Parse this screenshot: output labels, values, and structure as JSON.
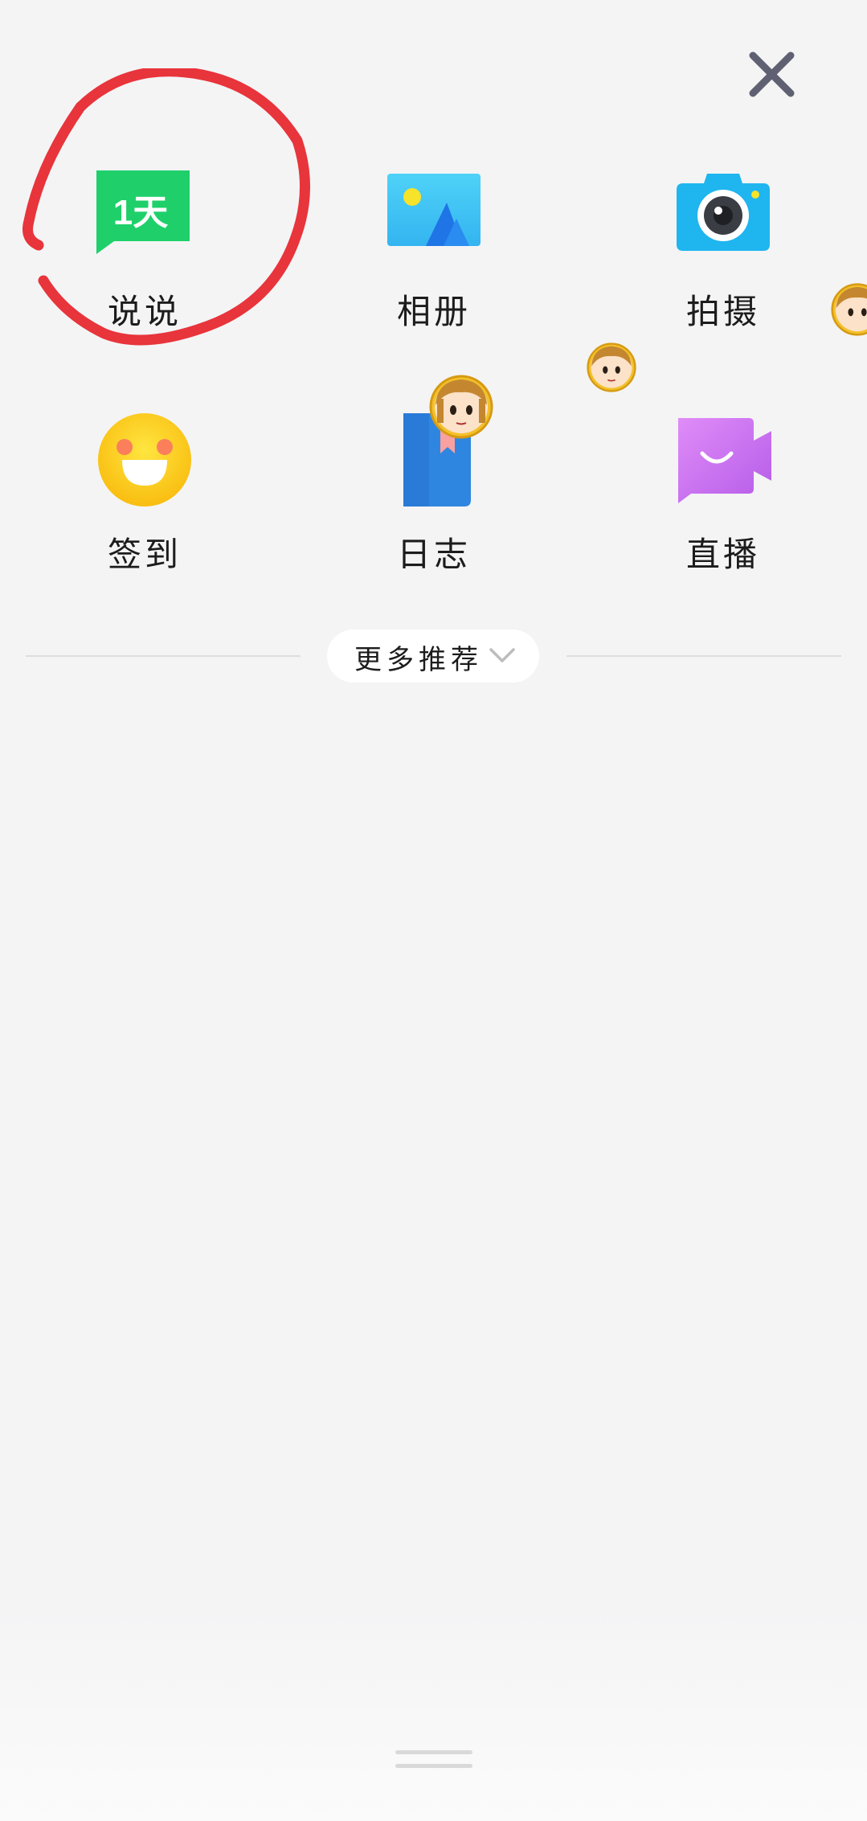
{
  "close": {
    "icon": "close-icon"
  },
  "grid": {
    "items": [
      {
        "label": "说说",
        "icon": "mood-post-icon",
        "icon_text": "1天",
        "color": "#1fd06a"
      },
      {
        "label": "相册",
        "icon": "photo-album-icon",
        "color": "#3ec8f5"
      },
      {
        "label": "拍摄",
        "icon": "camera-icon",
        "color": "#22b8f0"
      },
      {
        "label": "签到",
        "icon": "check-in-smiley-icon",
        "color": "#fcc816"
      },
      {
        "label": "日志",
        "icon": "journal-book-icon",
        "color": "#2f86e0"
      },
      {
        "label": "直播",
        "icon": "live-video-icon",
        "color": "#c66bf2"
      }
    ]
  },
  "more": {
    "label": "更多推荐",
    "icon": "chevron-down-icon"
  },
  "annotation": {
    "color": "#e8343b",
    "shape": "hand-drawn-circle"
  },
  "avatars": {
    "icon": "cartoon-avatar-icon",
    "count": 3
  }
}
